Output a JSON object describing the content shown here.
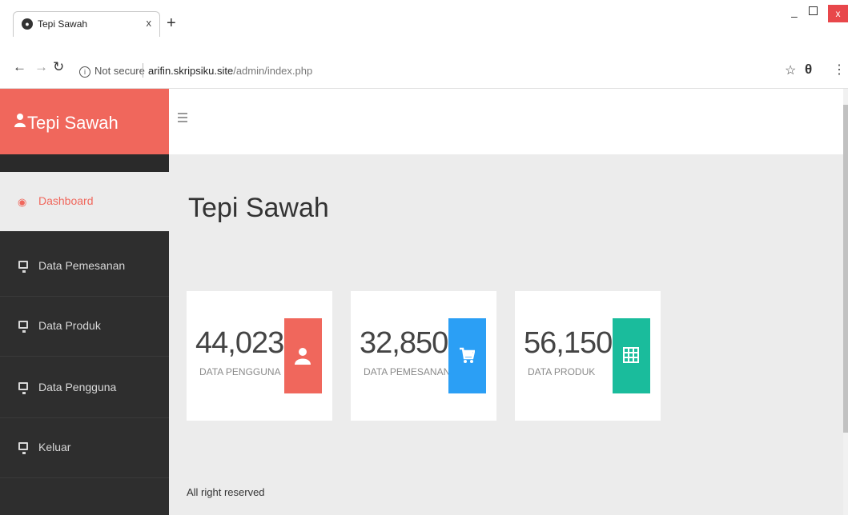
{
  "browser": {
    "tab_title": "Tepi Sawah",
    "tab_close": "x",
    "new_tab": "+",
    "security_label": "Not secure",
    "url_host": "arifin.skripsiku.site",
    "url_path": "/admin/index.php",
    "win_close": "x"
  },
  "sidebar": {
    "brand": "Tepi Sawah",
    "items": [
      {
        "label": "Dashboard",
        "icon": "dashboard-icon"
      },
      {
        "label": "Data Pemesanan",
        "icon": "monitor-icon"
      },
      {
        "label": "Data Produk",
        "icon": "monitor-icon"
      },
      {
        "label": "Data Pengguna",
        "icon": "monitor-icon"
      },
      {
        "label": "Keluar",
        "icon": "monitor-icon"
      }
    ]
  },
  "main": {
    "title": "Tepi Sawah",
    "cards": [
      {
        "value": "44,023",
        "caption": "DATA PENGGUNA",
        "color": "#f0675c",
        "icon": "user-icon"
      },
      {
        "value": "32,850",
        "caption": "DATA PEMESANAN",
        "color": "#2b9ff5",
        "icon": "cart-icon"
      },
      {
        "value": "56,150",
        "caption": "DATA PRODUK",
        "color": "#1abc9c",
        "icon": "grid-icon"
      }
    ],
    "footer": "All right reserved"
  },
  "colors": {
    "accent": "#f0675c",
    "sidebar": "#2e2e2e",
    "content_bg": "#ececec"
  }
}
